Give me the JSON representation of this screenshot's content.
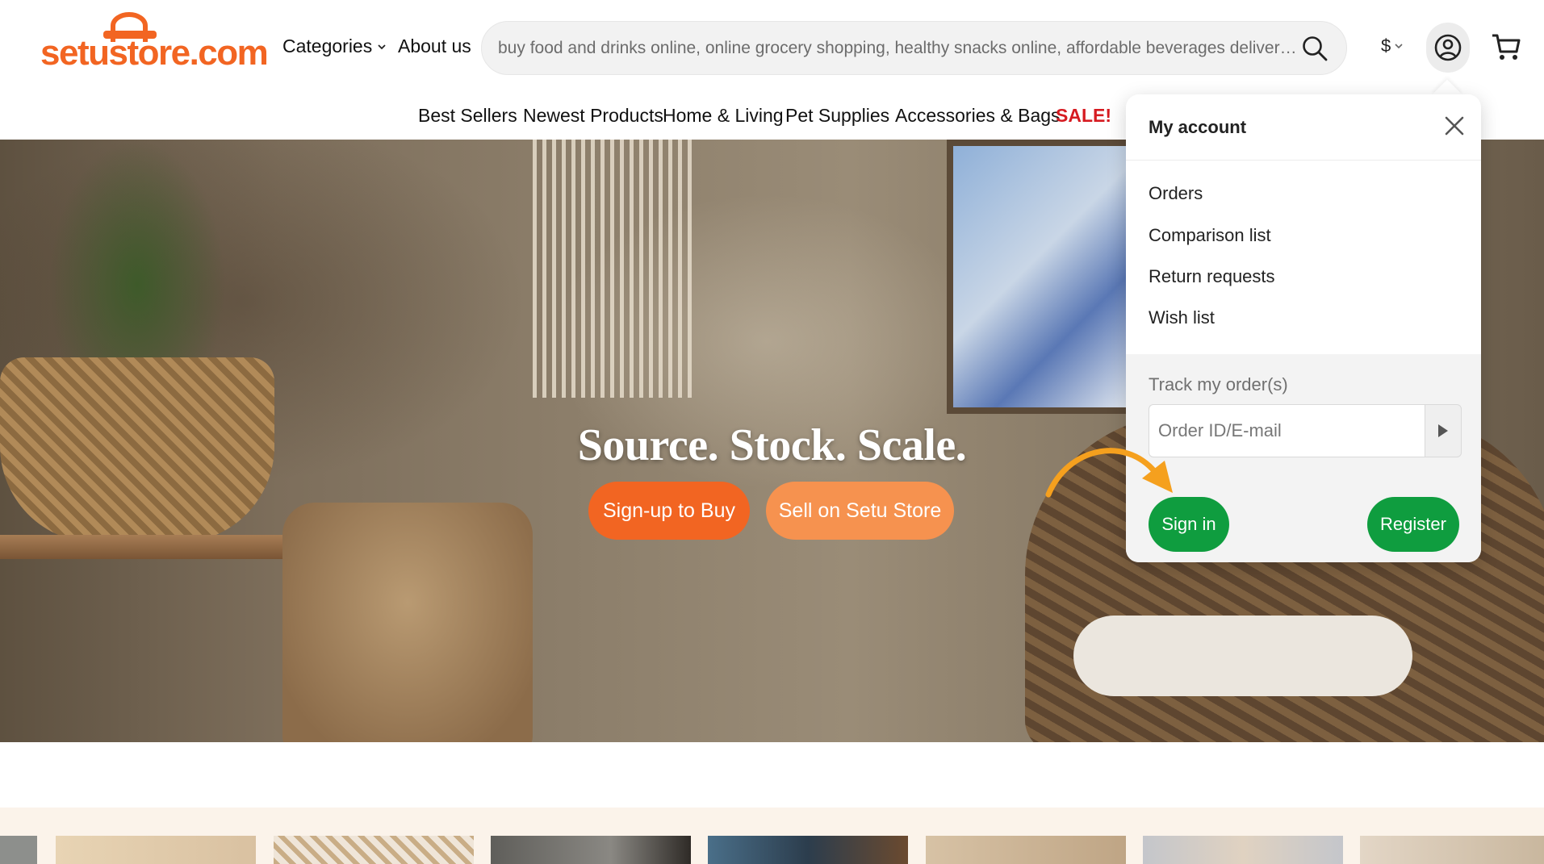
{
  "brand": {
    "logo_text": "setustore.com",
    "accent": "#f26522"
  },
  "header": {
    "nav_categories": "Categories",
    "nav_about": "About us",
    "search_placeholder": "buy food and drinks online, online grocery shopping, healthy snacks online, affordable beverages delivery, grocery delivery",
    "currency": "$"
  },
  "subnav": [
    "Best Sellers",
    "Newest Products",
    "Home & Living",
    "Pet Supplies",
    "Accessories & Bags",
    "SALE!"
  ],
  "hero": {
    "title": "Source. Stock. Scale.",
    "btn_signup": "Sign-up to Buy",
    "btn_sell": "Sell on Setu Store"
  },
  "account_menu": {
    "title": "My account",
    "items": [
      "Orders",
      "Comparison list",
      "Return requests",
      "Wish list"
    ],
    "track_label": "Track my order(s)",
    "track_placeholder": "Order ID/E-mail",
    "sign_in": "Sign in",
    "register": "Register",
    "button_color": "#0f9d3f"
  },
  "icons": [
    "search-icon",
    "chevron-down-icon",
    "user-circle-icon",
    "cart-icon",
    "close-icon",
    "play-arrow-icon",
    "pointer-arrow-icon"
  ]
}
